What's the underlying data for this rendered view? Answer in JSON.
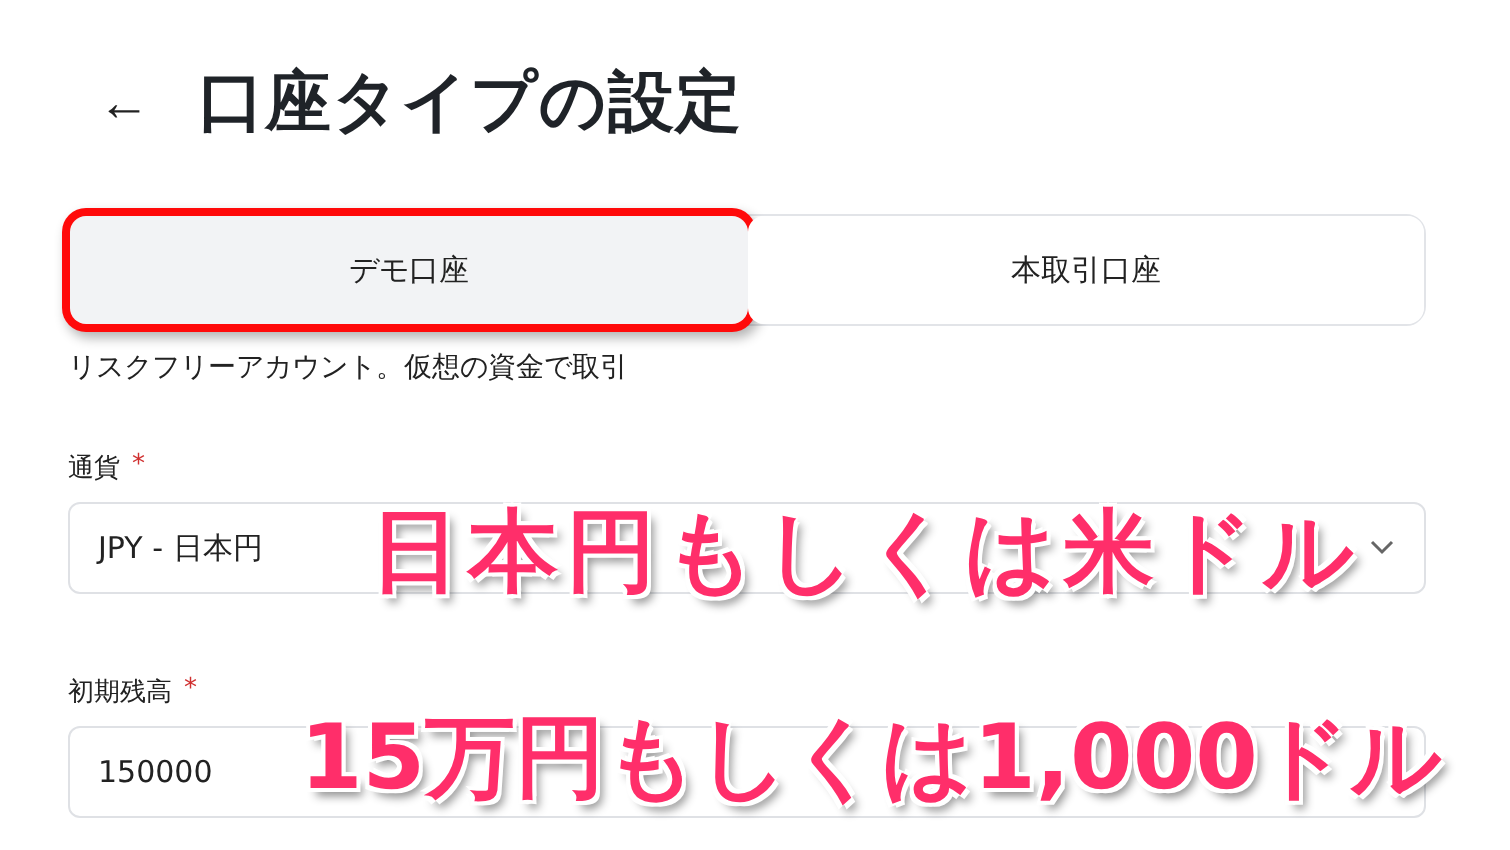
{
  "header": {
    "back": "←",
    "title": "口座タイプの設定"
  },
  "tabs": [
    {
      "label": "デモ口座",
      "selected": true,
      "highlighted": true
    },
    {
      "label": "本取引口座",
      "selected": false,
      "highlighted": false
    }
  ],
  "description": "リスクフリーアカウント。仮想の資金で取引",
  "fields": [
    {
      "kind": "select",
      "label": "通貨",
      "required_mark": "*",
      "value": "JPY - 日本円",
      "annotation": "日本円もしくは米ドル"
    },
    {
      "kind": "input",
      "label": "初期残高",
      "required_mark": "*",
      "value": "150000",
      "annotation": "15万円もしくは1,000ドル"
    }
  ]
}
